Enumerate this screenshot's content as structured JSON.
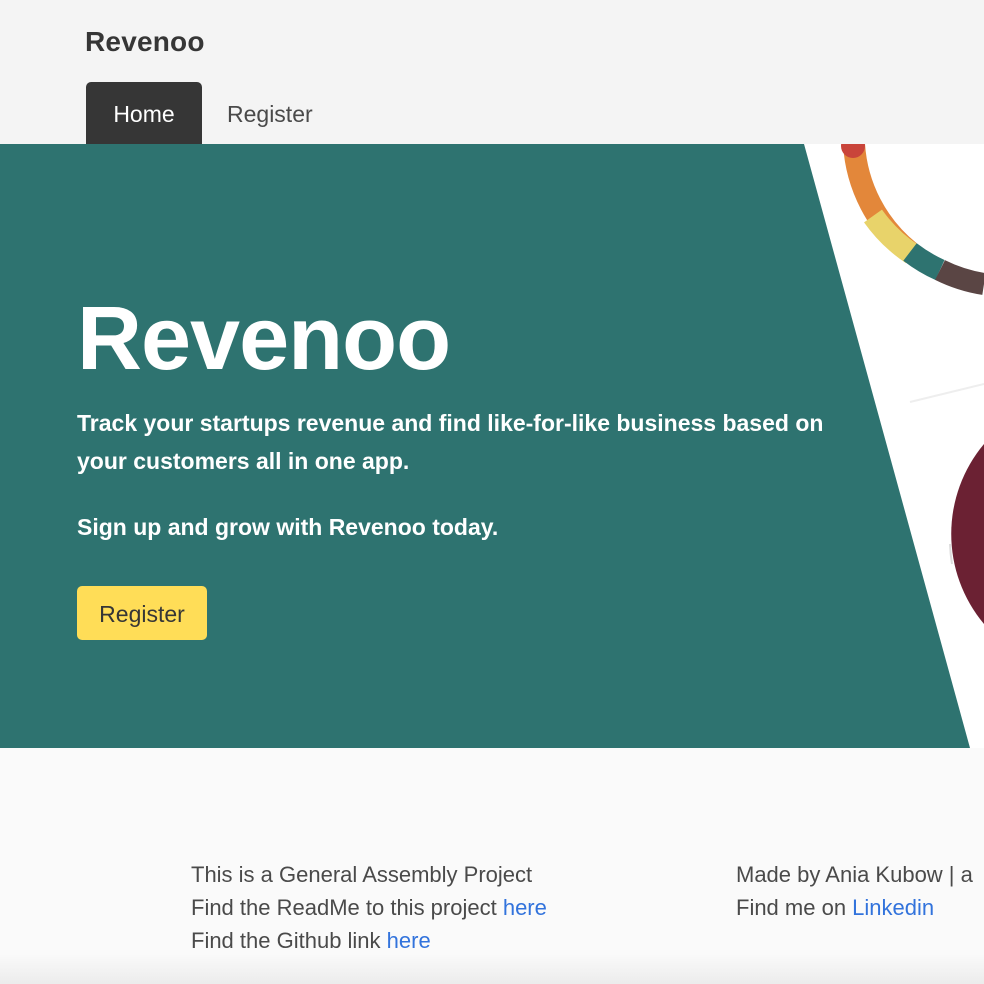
{
  "header": {
    "brand": "Revenoo",
    "tabs": [
      {
        "label": "Home",
        "active": true
      },
      {
        "label": "Register",
        "active": false
      }
    ]
  },
  "hero": {
    "title": "Revenoo",
    "subtitle": "Track your startups revenue and find like-for-like business based on your customers all in one app.",
    "cta_text": "Sign up and grow with Revenoo today.",
    "button_label": "Register"
  },
  "footer": {
    "left": {
      "line1": "This is a General Assembly Project",
      "line2_prefix": "Find the ReadMe to this project ",
      "line2_link": "here",
      "line3_prefix": "Find the Github link ",
      "line3_link": "here"
    },
    "right": {
      "line1": "Made by Ania Kubow | a",
      "line2_prefix": "Find me on ",
      "line2_link": "Linkedin"
    }
  },
  "colors": {
    "hero_background": "#2e7370",
    "button": "#ffdd57",
    "nav_active": "#363636",
    "link": "#3273dc"
  }
}
